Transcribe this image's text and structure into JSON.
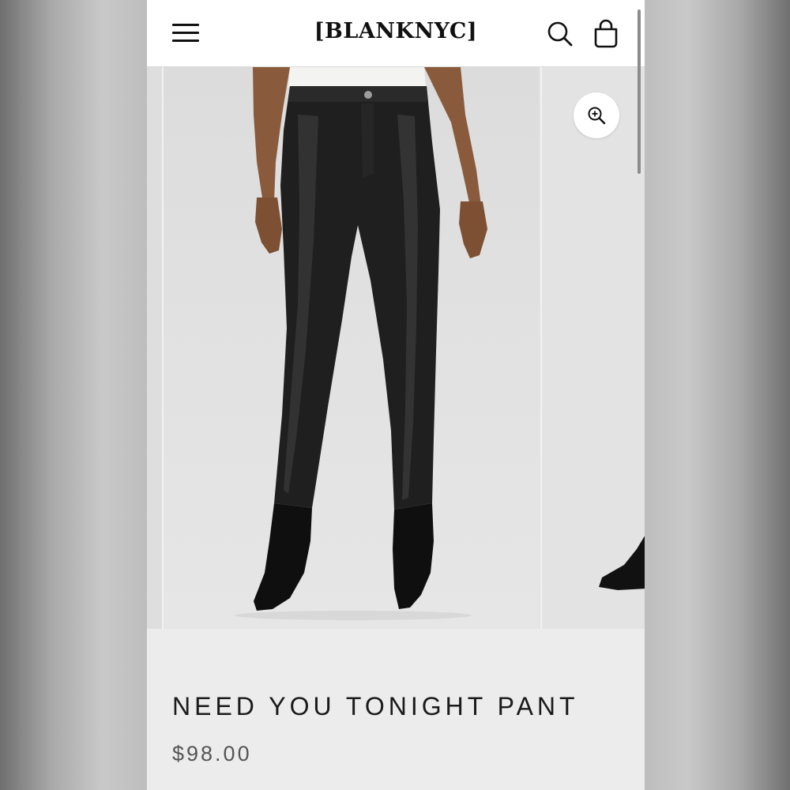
{
  "header": {
    "logo": "[BLANKNYC]",
    "menu_icon": "hamburger-menu-icon",
    "search_icon": "search-icon",
    "cart_icon": "shopping-bag-icon"
  },
  "gallery": {
    "zoom_icon": "zoom-in-icon",
    "main_image": "black faux leather straight-leg pants with black suede ankle boots",
    "next_image": "black suede pointed boot"
  },
  "product": {
    "name": "NEED YOU TONIGHT PANT",
    "price": "$98.00"
  },
  "colors": {
    "header_bg": "#ffffff",
    "page_bg": "#ececec",
    "text": "#1a1a1a",
    "price_text": "#555555"
  }
}
